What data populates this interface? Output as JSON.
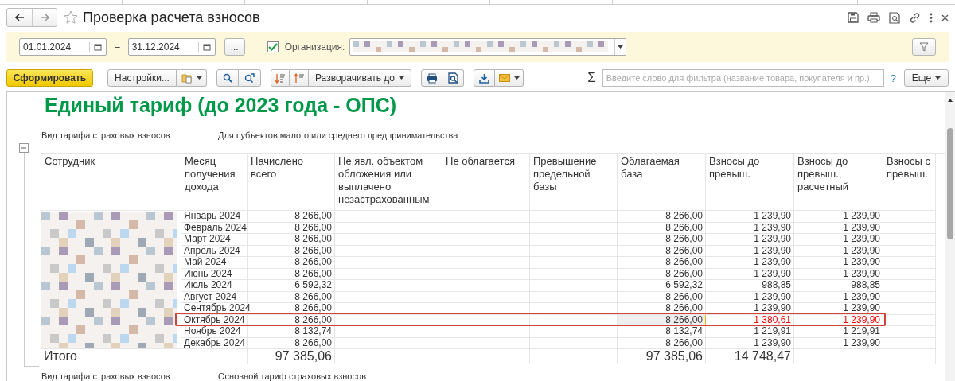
{
  "window": {
    "title": "Проверка расчета взносов"
  },
  "filters": {
    "date_from": "01.01.2024",
    "dash": "–",
    "date_to": "31.12.2024",
    "more_button": "...",
    "organization_enabled": true,
    "organization_label": "Организация:"
  },
  "toolbar": {
    "generate": "Сформировать",
    "settings": "Настройки...",
    "expand": "Разворачивать до",
    "sum_sign": "Σ",
    "filter_placeholder": "Введите слово для фильтра (название товара, покупателя и пр.)",
    "help": "?",
    "more": "Еще"
  },
  "report": {
    "title": "Единый тариф (до 2023 года - ОПС)",
    "tariff_label": "Вид тарифа страховых взносов",
    "tariff_value": "Для субъектов малого или среднего предпринимательства",
    "columns": [
      "Сотрудник",
      "Месяц получения дохода",
      "Начислено всего",
      "Не явл. объектом обложения или выплачено незастрахованным",
      "Не облагается",
      "Превышение предельной базы",
      "Облагаемая база",
      "Взносы до превыш.",
      "Взносы до превыш., расчетный",
      "Взносы с превыш."
    ],
    "rows": [
      {
        "month": "Январь 2024",
        "accrued": "8 266,00",
        "base": "8 266,00",
        "contrib": "1 239,90",
        "contrib_calc": "1 239,90",
        "flagged": false,
        "cursor": false
      },
      {
        "month": "Февраль 2024",
        "accrued": "8 266,00",
        "base": "8 266,00",
        "contrib": "1 239,90",
        "contrib_calc": "1 239,90",
        "flagged": false,
        "cursor": false
      },
      {
        "month": "Март 2024",
        "accrued": "8 266,00",
        "base": "8 266,00",
        "contrib": "1 239,90",
        "contrib_calc": "1 239,90",
        "flagged": false,
        "cursor": false
      },
      {
        "month": "Апрель 2024",
        "accrued": "8 266,00",
        "base": "8 266,00",
        "contrib": "1 239,90",
        "contrib_calc": "1 239,90",
        "flagged": false,
        "cursor": false
      },
      {
        "month": "Май 2024",
        "accrued": "8 266,00",
        "base": "8 266,00",
        "contrib": "1 239,90",
        "contrib_calc": "1 239,90",
        "flagged": false,
        "cursor": false
      },
      {
        "month": "Июнь 2024",
        "accrued": "8 266,00",
        "base": "8 266,00",
        "contrib": "1 239,90",
        "contrib_calc": "1 239,90",
        "flagged": false,
        "cursor": false
      },
      {
        "month": "Июль 2024",
        "accrued": "6 592,32",
        "base": "6 592,32",
        "contrib": "988,85",
        "contrib_calc": "988,85",
        "flagged": false,
        "cursor": false
      },
      {
        "month": "Август 2024",
        "accrued": "8 266,00",
        "base": "8 266,00",
        "contrib": "1 239,90",
        "contrib_calc": "1 239,90",
        "flagged": false,
        "cursor": false
      },
      {
        "month": "Сентябрь 2024",
        "accrued": "8 266,00",
        "base": "8 266,00",
        "contrib": "1 239,90",
        "contrib_calc": "1 239,90",
        "flagged": false,
        "cursor": false
      },
      {
        "month": "Октябрь 2024",
        "accrued": "8 266,00",
        "base": "8 266,00",
        "contrib": "1 380,61",
        "contrib_calc": "1 239,90",
        "flagged": true,
        "cursor": true
      },
      {
        "month": "Ноябрь 2024",
        "accrued": "8 132,74",
        "base": "8 132,74",
        "contrib": "1 219,91",
        "contrib_calc": "1 219,91",
        "flagged": false,
        "cursor": false
      },
      {
        "month": "Декабрь 2024",
        "accrued": "8 266,00",
        "base": "8 266,00",
        "contrib": "1 239,90",
        "contrib_calc": "1 239,90",
        "flagged": false,
        "cursor": false
      }
    ],
    "total": {
      "label": "Итого",
      "accrued": "97 385,06",
      "base": "97 385,06",
      "contrib": "14 748,47"
    },
    "next_tariff_label": "Вид тарифа страховых взносов",
    "next_tariff_value": "Основной тариф страховых взносов"
  }
}
